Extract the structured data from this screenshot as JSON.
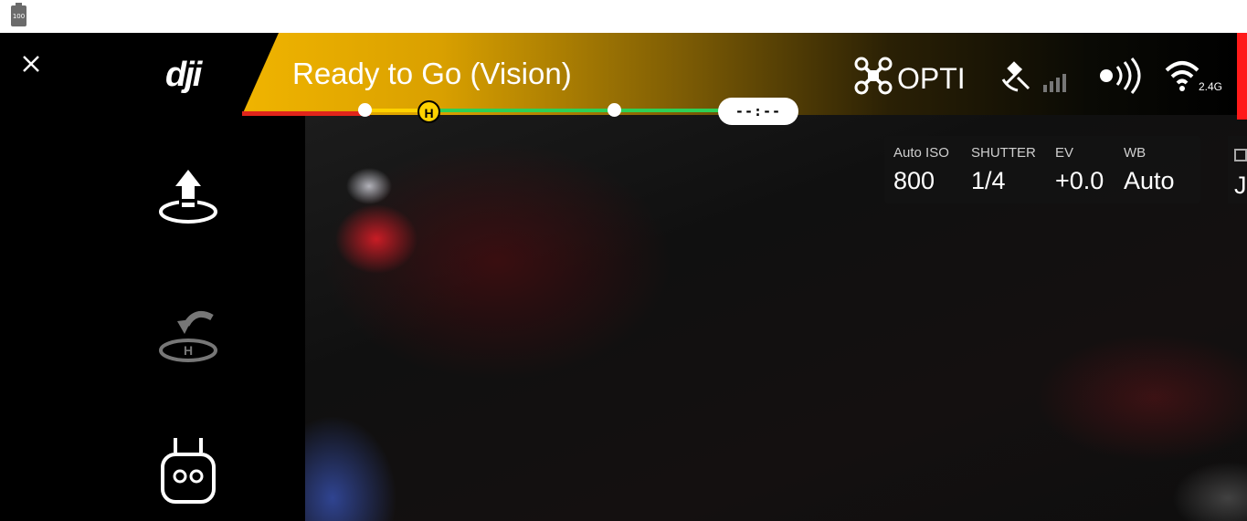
{
  "status_bar": {
    "battery_level": "100"
  },
  "app": {
    "logo": "dji",
    "status_title": "Ready to Go (Vision)",
    "battery_timeline": {
      "home_marker": "H",
      "time_remaining": "--:--"
    },
    "flight_mode": "OPTI",
    "wifi_band": "2.4G",
    "left_panel": {
      "buttons": [
        "auto-takeoff",
        "return-to-home",
        "remote-controller"
      ]
    },
    "camera_params": {
      "iso": {
        "label": "Auto ISO",
        "value": "800"
      },
      "shutter": {
        "label": "SHUTTER",
        "value": "1/4"
      },
      "ev": {
        "label": "EV",
        "value": "+0.0"
      },
      "wb": {
        "label": "WB",
        "value": "Auto"
      },
      "format_partial": "J"
    },
    "colors": {
      "ready_gradient": "#f0b400",
      "battery_low": "#e1251b",
      "battery_mid": "#ffd200",
      "battery_ok": "#2ecf56",
      "alert_edge": "#ff1a1a"
    }
  }
}
